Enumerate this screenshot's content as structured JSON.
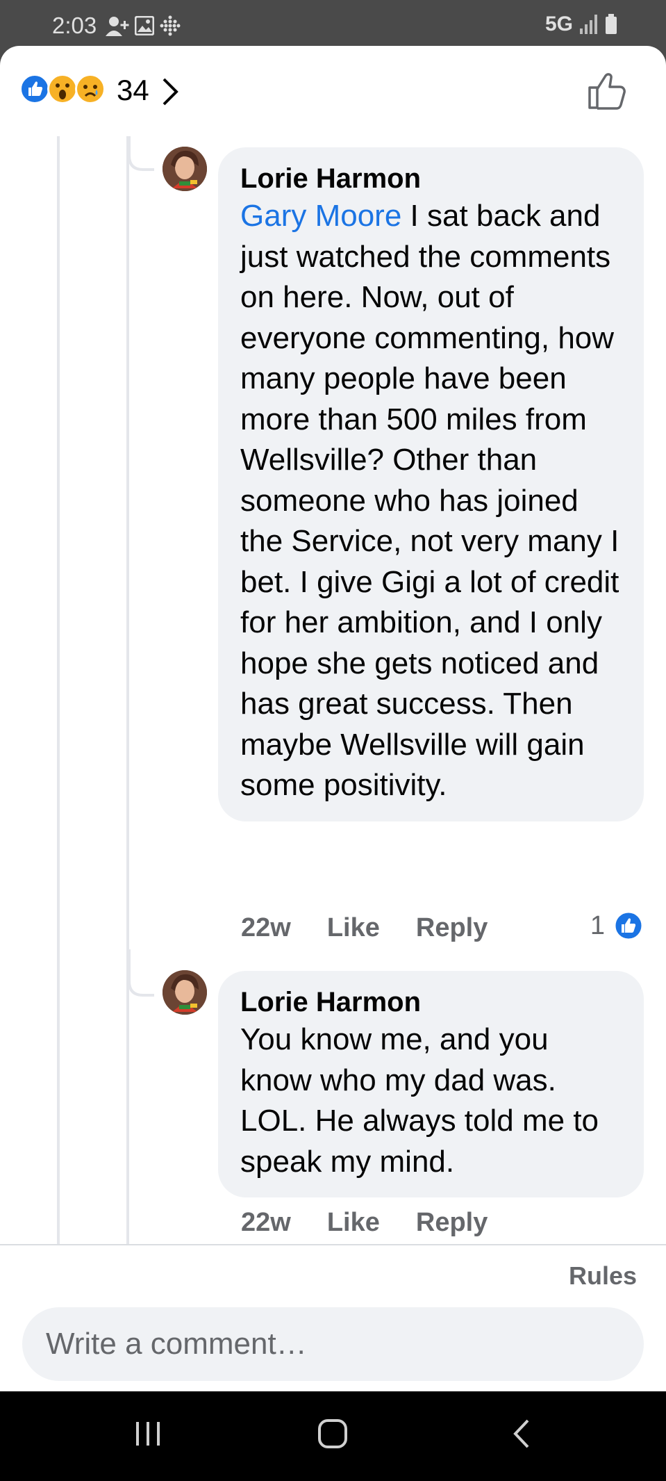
{
  "status_bar": {
    "time": "2:03",
    "network": "5G",
    "icons": [
      "person-add-icon",
      "image-icon",
      "dots-grid-icon",
      "signal-icon",
      "battery-icon"
    ]
  },
  "reactions": {
    "types": [
      "like",
      "wow",
      "sad"
    ],
    "count": "34"
  },
  "comments": [
    {
      "author": "Lorie Harmon",
      "mention": "Gary Moore",
      "text": " I sat back and just watched the comments on here. Now, out of everyone commenting, how many people have been more than 500 miles from Wellsville? Other than someone who has joined the Service, not very many I bet. I give Gigi a lot of credit for her ambition, and I only hope she gets noticed and has great success. Then maybe Wellsville will gain some positivity.",
      "time": "22w",
      "like_label": "Like",
      "reply_label": "Reply",
      "reaction_count": "1"
    },
    {
      "author": "Lorie Harmon",
      "text": "You know me, and you know who my dad was. LOL. He always told me to speak my mind.",
      "time": "22w",
      "like_label": "Like",
      "reply_label": "Reply"
    }
  ],
  "footer": {
    "rules_label": "Rules",
    "compose_placeholder": "Write a comment…"
  },
  "colors": {
    "accent": "#1b74e4",
    "bubble": "#f0f2f5",
    "meta_text": "#65676b"
  }
}
